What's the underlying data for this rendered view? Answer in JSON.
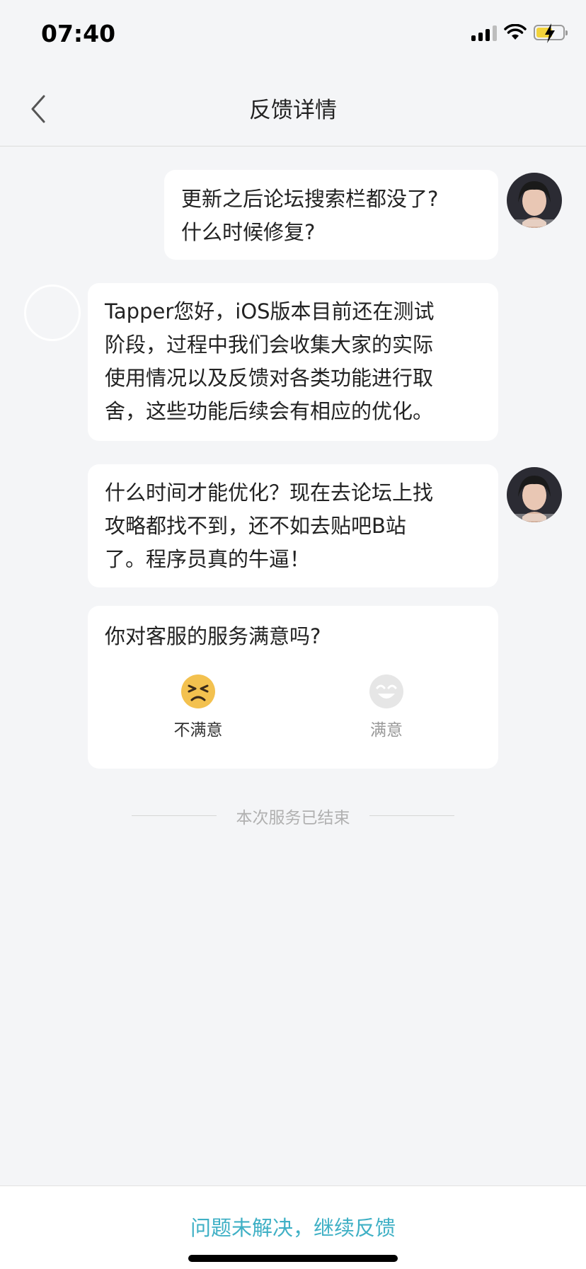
{
  "status_bar": {
    "time": "07:40"
  },
  "nav": {
    "title": "反馈详情"
  },
  "messages": [
    {
      "sender": "user",
      "lines": [
        "更新之后论坛搜索栏都没了?",
        "什么时候修复?"
      ]
    },
    {
      "sender": "support",
      "lines": [
        "Tapper您好，iOS版本目前还在测试",
        "阶段，过程中我们会收集大家的实际",
        "使用情况以及反馈对各类功能进行取",
        "舍，这些功能后续会有相应的优化。"
      ]
    },
    {
      "sender": "user",
      "lines": [
        "什么时间才能优化？现在去论坛上找",
        "攻略都找不到，还不如去贴吧B站",
        "了。程序员真的牛逼！"
      ]
    }
  ],
  "rating": {
    "question": "你对客服的服务满意吗?",
    "options": [
      {
        "label": "不满意",
        "icon": "unsatisfied-face-icon",
        "color": "#f3c14f"
      },
      {
        "label": "满意",
        "icon": "satisfied-face-icon",
        "color": "#e3e3e3"
      }
    ]
  },
  "session_end": "本次服务已结束",
  "bottom": {
    "continue_label": "问题未解决，继续反馈"
  },
  "colors": {
    "accent": "#3fb0c5",
    "background": "#f4f5f7"
  }
}
